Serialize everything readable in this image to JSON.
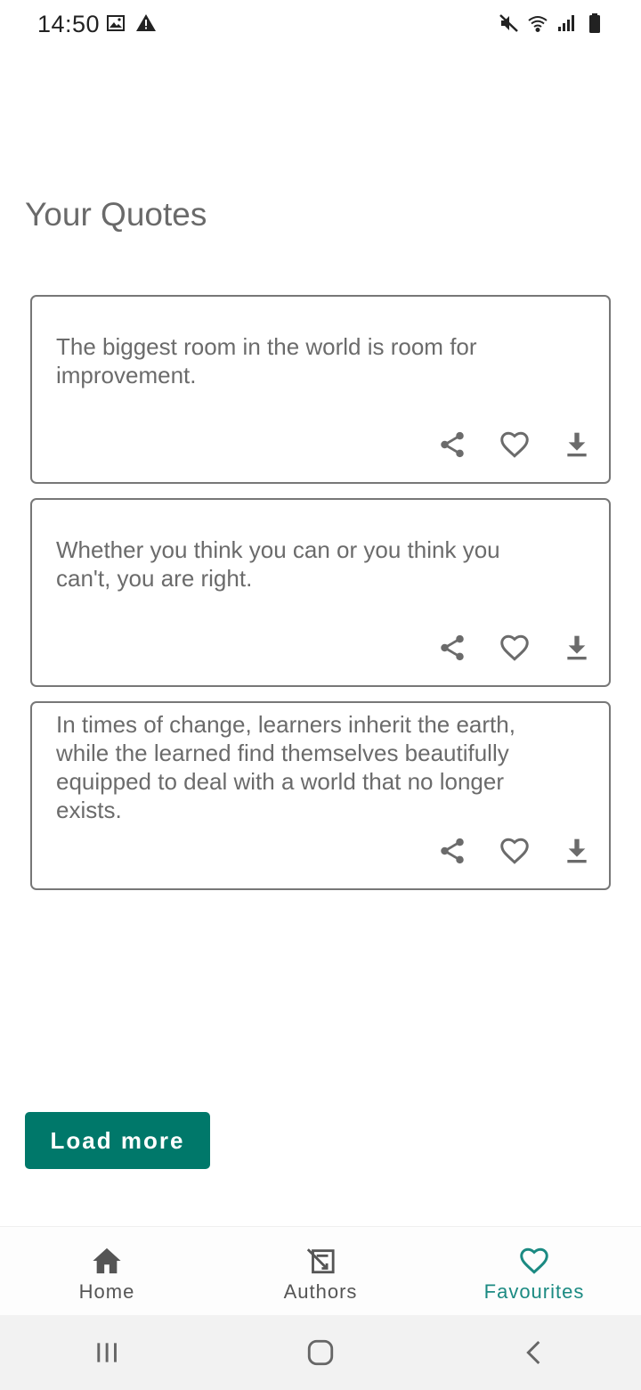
{
  "status_bar": {
    "time": "14:50",
    "left_icons": [
      "image-icon",
      "warning-icon"
    ],
    "right_icons": [
      "mute-icon",
      "wifi-icon",
      "signal-icon",
      "battery-icon"
    ]
  },
  "page": {
    "title": "Your Quotes"
  },
  "quotes": [
    {
      "text": "The biggest room in the world is room for improvement."
    },
    {
      "text": "Whether you think you can or you think you can't, you are right."
    },
    {
      "text": "In times of change, learners inherit the earth, while the learned find themselves beautifully equipped to deal with a world that no longer exists."
    }
  ],
  "actions": {
    "icons": [
      "share-icon",
      "heart-outline-icon",
      "download-icon"
    ]
  },
  "load_more": {
    "label": "Load more"
  },
  "bottom_nav": {
    "items": [
      {
        "label": "Home",
        "icon": "home-icon",
        "active": false
      },
      {
        "label": "Authors",
        "icon": "authors-icon",
        "active": false
      },
      {
        "label": "Favourites",
        "icon": "heart-outline-icon",
        "active": true
      }
    ],
    "active_color": "#1b8a82",
    "inactive_color": "#555555"
  },
  "system_nav": {
    "icons": [
      "recent-apps-icon",
      "home-circle-icon",
      "back-icon"
    ]
  },
  "colors": {
    "accent": "#00786a",
    "text": "#6b6b6b",
    "card_border": "#777777"
  }
}
